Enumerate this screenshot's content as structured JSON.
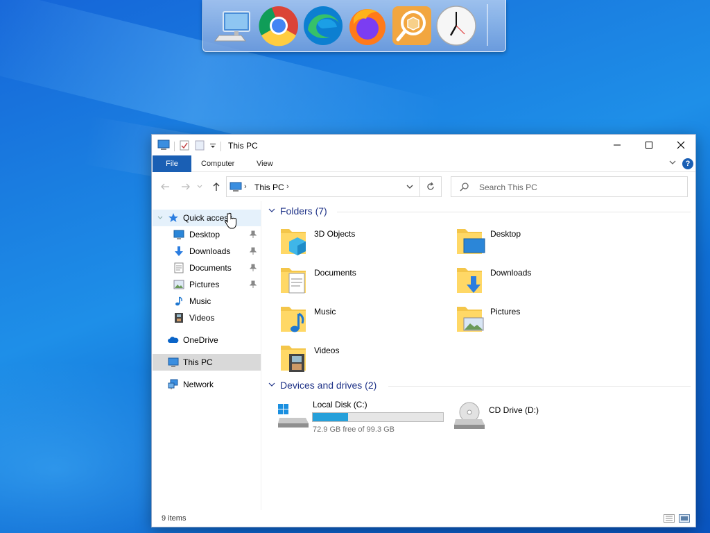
{
  "dock": {
    "items": [
      {
        "name": "this-pc-icon"
      },
      {
        "name": "chrome-icon"
      },
      {
        "name": "edge-icon"
      },
      {
        "name": "firefox-icon"
      },
      {
        "name": "package-search-icon"
      },
      {
        "name": "clock-icon"
      }
    ]
  },
  "window": {
    "title": "This PC",
    "ribbon": {
      "file": "File",
      "computer": "Computer",
      "view": "View"
    },
    "address": {
      "crumb": "This PC",
      "sep": "›"
    },
    "search_placeholder": "Search This PC",
    "nav": {
      "quick_access": "Quick access",
      "desktop": "Desktop",
      "downloads": "Downloads",
      "documents": "Documents",
      "pictures": "Pictures",
      "music": "Music",
      "videos": "Videos",
      "onedrive": "OneDrive",
      "this_pc": "This PC",
      "network": "Network"
    },
    "groups": {
      "folders": "Folders (7)",
      "devices": "Devices and drives (2)"
    },
    "folders": {
      "objects3d": "3D Objects",
      "desktop": "Desktop",
      "documents": "Documents",
      "downloads": "Downloads",
      "music": "Music",
      "pictures": "Pictures",
      "videos": "Videos"
    },
    "drives": {
      "c_name": "Local Disk (C:)",
      "c_free": "72.9 GB free of 99.3 GB",
      "c_used_fraction": 0.27,
      "d_name": "CD Drive (D:)"
    },
    "status": {
      "count": "9 items"
    }
  },
  "colors": {
    "accent": "#1a5fb4",
    "group_header": "#1e3287",
    "drive_bar": "#26a0da"
  }
}
